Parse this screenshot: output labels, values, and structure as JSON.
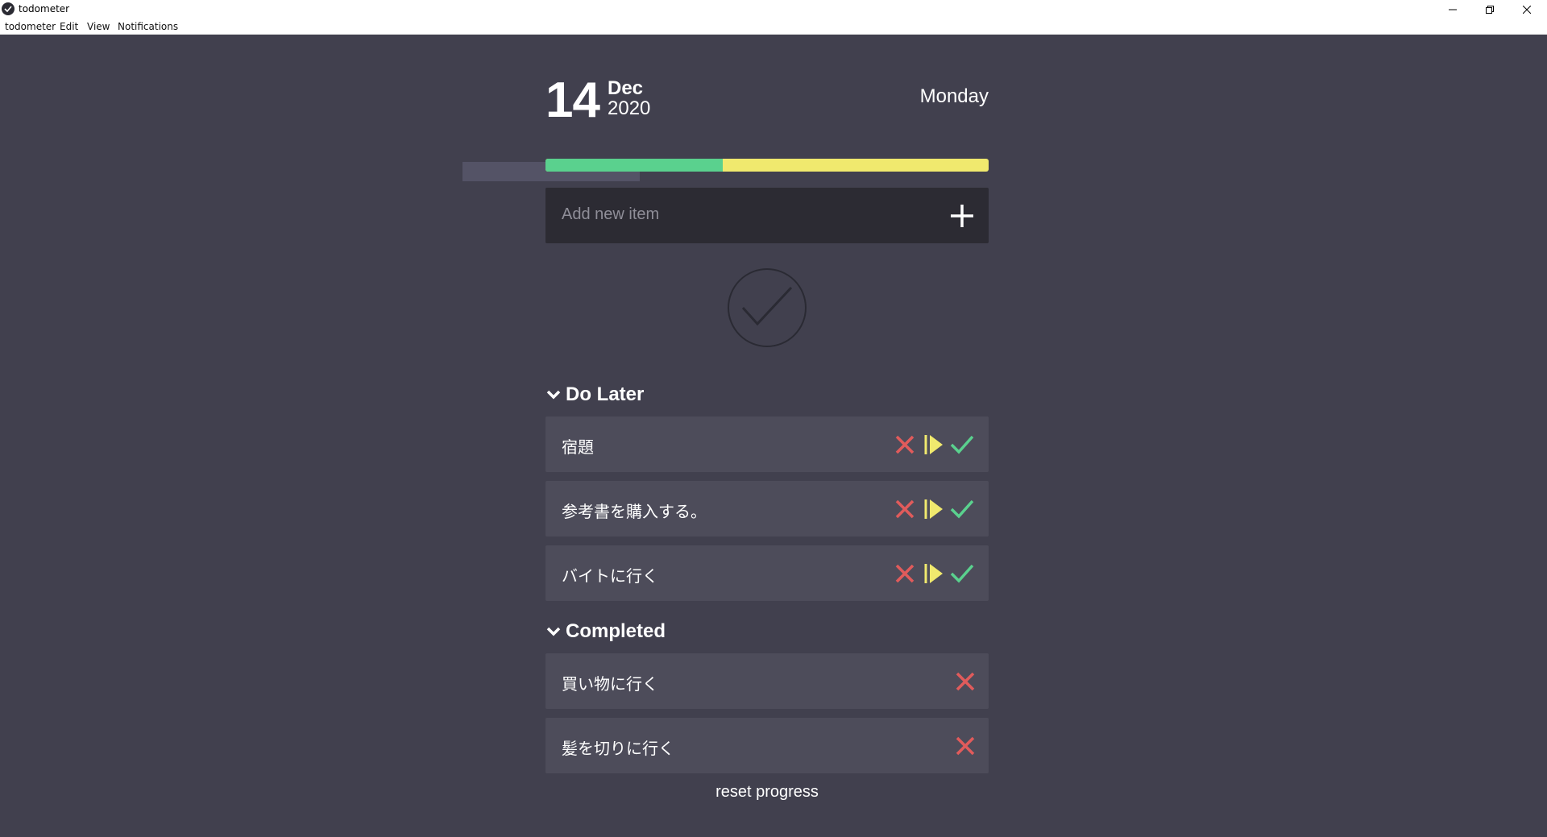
{
  "window": {
    "title": "todometer",
    "controls": [
      "minimize-icon",
      "restore-icon",
      "close-icon"
    ]
  },
  "menu": {
    "items": [
      "todometer",
      "Edit",
      "View",
      "Notifications"
    ]
  },
  "date": {
    "day": "14",
    "month": "Dec",
    "year": "2020",
    "weekday": "Monday"
  },
  "progress": {
    "completed_fraction": 0.4,
    "completed_color": "#5ad18e",
    "remaining_color": "#f0e96e"
  },
  "add_item": {
    "placeholder": "Add new item",
    "button_icon": "plus-icon"
  },
  "do_later": {
    "heading": "Do Later",
    "items": [
      {
        "text": "宿題"
      },
      {
        "text": "参考書を購入する。"
      },
      {
        "text": "バイトに行く"
      }
    ],
    "actions": [
      "delete-icon",
      "do-later-icon",
      "complete-icon"
    ]
  },
  "completed": {
    "heading": "Completed",
    "items": [
      {
        "text": "買い物に行く"
      },
      {
        "text": "髪を切りに行く"
      }
    ],
    "actions": [
      "delete-icon"
    ]
  },
  "footer": {
    "reset_label": "reset progress"
  },
  "colors": {
    "background": "#41404e",
    "card": "#4d4c5a",
    "input": "#2c2b33",
    "delete": "#e15b5b",
    "later": "#f0e96e",
    "complete": "#5ad18e"
  }
}
